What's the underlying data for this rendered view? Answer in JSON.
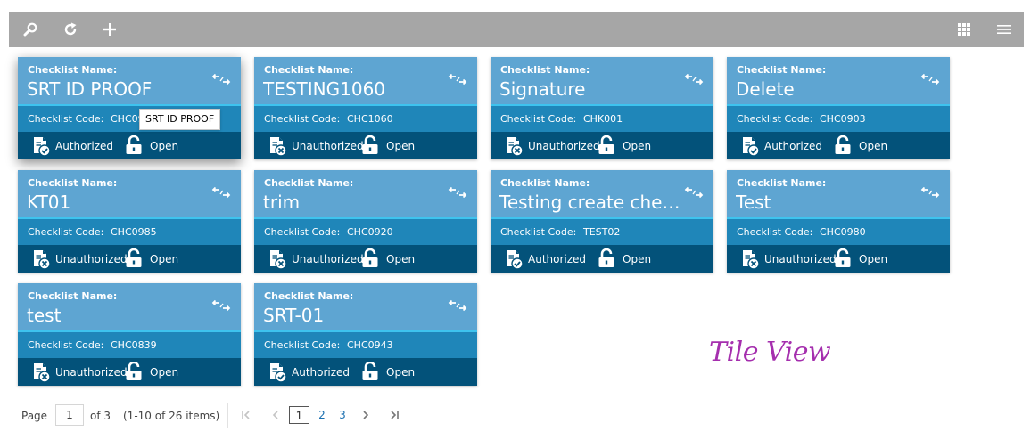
{
  "toolbar": {
    "search_icon": "search-icon",
    "refresh_icon": "refresh-icon",
    "add_icon": "add-icon",
    "tile_view_icon": "grid-view-icon",
    "list_view_icon": "list-view-icon"
  },
  "labels": {
    "name": "Checklist Name:",
    "code": "Checklist Code:"
  },
  "cards": [
    {
      "name": "SRT ID PROOF",
      "code": "CHC0985",
      "auth": "Authorized",
      "status": "Open"
    },
    {
      "name": "TESTING1060",
      "code": "CHC1060",
      "auth": "Unauthorized",
      "status": "Open"
    },
    {
      "name": "Signature",
      "code": "CHK001",
      "auth": "Unauthorized",
      "status": "Open"
    },
    {
      "name": "Delete",
      "code": "CHC0903",
      "auth": "Authorized",
      "status": "Open"
    },
    {
      "name": "KT01",
      "code": "CHC0985",
      "auth": "Unauthorized",
      "status": "Open"
    },
    {
      "name": "trim",
      "code": "CHC0920",
      "auth": "Unauthorized",
      "status": "Open"
    },
    {
      "name": "Testing create checklist",
      "code": "TEST02",
      "auth": "Authorized",
      "status": "Open"
    },
    {
      "name": "Test",
      "code": "CHC0980",
      "auth": "Unauthorized",
      "status": "Open"
    },
    {
      "name": "test",
      "code": "CHC0839",
      "auth": "Unauthorized",
      "status": "Open"
    },
    {
      "name": "SRT-01",
      "code": "CHC0943",
      "auth": "Authorized",
      "status": "Open"
    }
  ],
  "tooltip": "SRT ID PROOF",
  "watermark": "Tile View",
  "pager": {
    "page_label": "Page",
    "current_value": "1",
    "of_label": "of 3",
    "items_label": "(1-10 of 26 items)",
    "pages": [
      "1",
      "2",
      "3"
    ],
    "current_page": "1"
  },
  "colors": {
    "toolbar": "#a6a6a6",
    "card_top": "#5ea5d2",
    "card_mid": "#1f86b9",
    "card_divider": "#3ec3ee",
    "card_bottom": "#03527a",
    "watermark": "#a52fae",
    "link": "#1a6fb0"
  }
}
